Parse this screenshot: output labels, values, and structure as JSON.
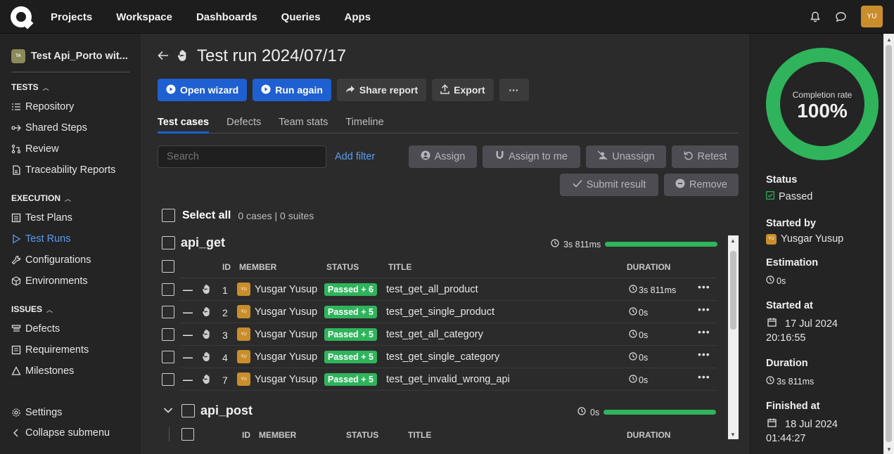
{
  "topnav": {
    "items": [
      "Projects",
      "Workspace",
      "Dashboards",
      "Queries",
      "Apps"
    ],
    "avatar": "YU"
  },
  "sidebar": {
    "project": {
      "avatar": "TA",
      "name": "Test Api_Porto wit..."
    },
    "sections": {
      "tests": "TESTS",
      "execution": "EXECUTION",
      "issues": "ISSUES"
    },
    "tests_items": [
      "Repository",
      "Shared Steps",
      "Review",
      "Traceability Reports"
    ],
    "execution_items": [
      "Test Plans",
      "Test Runs",
      "Configurations",
      "Environments"
    ],
    "issues_items": [
      "Defects",
      "Requirements",
      "Milestones"
    ],
    "settings": "Settings",
    "collapse": "Collapse submenu"
  },
  "header": {
    "title": "Test run 2024/07/17"
  },
  "actions": {
    "open_wizard": "Open wizard",
    "run_again": "Run again",
    "share_report": "Share report",
    "export": "Export",
    "more": "···"
  },
  "tabs": [
    "Test cases",
    "Defects",
    "Team stats",
    "Timeline"
  ],
  "filters": {
    "search_placeholder": "Search",
    "add_filter": "Add filter",
    "assign": "Assign",
    "assign_to_me": "Assign to me",
    "unassign": "Unassign",
    "retest": "Retest",
    "submit_result": "Submit result",
    "remove": "Remove"
  },
  "selection": {
    "label": "Select all",
    "counts": "0 cases | 0 suites"
  },
  "columns": {
    "id": "ID",
    "member": "MEMBER",
    "status": "STATUS",
    "title": "TITLE",
    "duration": "DURATION"
  },
  "suites": [
    {
      "name": "api_get",
      "duration": "3s 811ms",
      "rows": [
        {
          "id": "1",
          "member": "Yusgar Yusup",
          "status": "Passed + 6",
          "title": "test_get_all_product",
          "duration": "3s 811ms"
        },
        {
          "id": "2",
          "member": "Yusgar Yusup",
          "status": "Passed + 5",
          "title": "test_get_single_product",
          "duration": "0s"
        },
        {
          "id": "3",
          "member": "Yusgar Yusup",
          "status": "Passed + 5",
          "title": "test_get_all_category",
          "duration": "0s"
        },
        {
          "id": "4",
          "member": "Yusgar Yusup",
          "status": "Passed + 5",
          "title": "test_get_single_category",
          "duration": "0s"
        },
        {
          "id": "7",
          "member": "Yusgar Yusup",
          "status": "Passed + 5",
          "title": "test_get_invalid_wrong_api",
          "duration": "0s"
        }
      ]
    },
    {
      "name": "api_post",
      "duration": "0s",
      "rows": []
    }
  ],
  "member_avatar": "YU",
  "summary": {
    "completion_label": "Completion rate",
    "completion_value": "100%",
    "completion_fraction": 1.0,
    "status_label": "Status",
    "status_value": "Passed",
    "started_by_label": "Started by",
    "started_by_value": "Yusgar Yusup",
    "estimation_label": "Estimation",
    "estimation_value": "0s",
    "started_at_label": "Started at",
    "started_at_date": "17 Jul 2024",
    "started_at_time": "20:16:55",
    "duration_label": "Duration",
    "duration_value": "3s 811ms",
    "finished_at_label": "Finished at",
    "finished_at_date": "18 Jul 2024",
    "finished_at_time": "01:44:27"
  },
  "colors": {
    "accent": "#1e5fd1",
    "passed": "#2fb45b",
    "link": "#5b9cf0",
    "avatar": "#c98e2b"
  }
}
